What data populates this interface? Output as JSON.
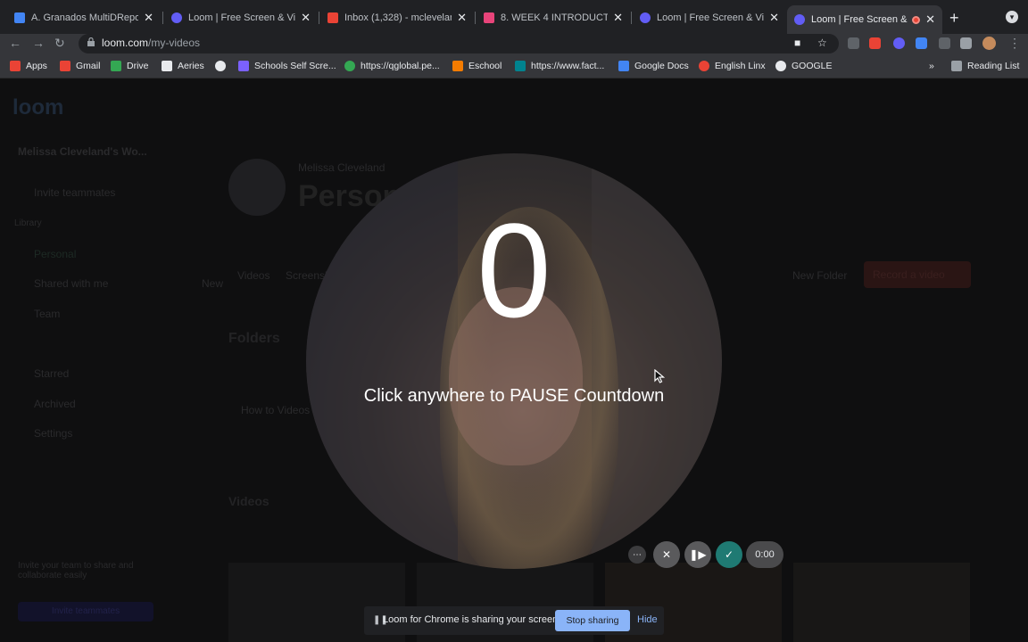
{
  "tabs": [
    {
      "title": "A. Granados MultiDReport",
      "favicon_color": "#4285f4"
    },
    {
      "title": "Loom | Free Screen & Video",
      "favicon_color": "#625df5"
    },
    {
      "title": "Inbox (1,328) - mcleveland",
      "favicon_color": "#ea4335"
    },
    {
      "title": "8. WEEK 4 INTRODUCTION",
      "favicon_color": "#e8447a"
    },
    {
      "title": "Loom | Free Screen & Video",
      "favicon_color": "#625df5"
    },
    {
      "title": "Loom | Free Screen & V",
      "favicon_color": "#625df5"
    }
  ],
  "toolbar": {
    "url_domain": "loom.com",
    "url_path": "/my-videos"
  },
  "bookmarks": [
    {
      "label": "Apps",
      "color": "#ea4335"
    },
    {
      "label": "Gmail",
      "color": "#ea4335"
    },
    {
      "label": "Drive",
      "color": "#34a853"
    },
    {
      "label": "Aeries",
      "color": "#e8eaed"
    },
    {
      "label": "",
      "color": "#e8eaed"
    },
    {
      "label": "Schools Self Scre...",
      "color": "#7b61ff"
    },
    {
      "label": "https://qglobal.pe...",
      "color": "#34a853"
    },
    {
      "label": "Eschool",
      "color": "#f57c00"
    },
    {
      "label": "https://www.fact...",
      "color": "#00838f"
    },
    {
      "label": "Google Docs",
      "color": "#4285f4"
    },
    {
      "label": "English Linx",
      "color": "#ea4335"
    },
    {
      "label": "GOOGLE",
      "color": "#e8eaed"
    }
  ],
  "reading_list": "Reading List",
  "overlay": {
    "countdown": "0",
    "hint": "Click anywhere to PAUSE Countdown"
  },
  "recorder": {
    "timer": "0:00"
  },
  "share_bar": {
    "message": "Loom for Chrome is sharing your screen.",
    "stop_label": "Stop sharing",
    "hide_label": "Hide"
  },
  "dimmed_page": {
    "logo": "loom",
    "workspace": "Melissa Cleveland's Wo...",
    "invite": "Invite teammates",
    "library": "Library",
    "nav": [
      "Personal",
      "Shared with me",
      "Team",
      "Starred",
      "Archived",
      "Settings"
    ],
    "profile_name": "Melissa Cleveland",
    "page_title": "Personal",
    "tabs": [
      "Videos",
      "Screenshots"
    ],
    "new_button": "New",
    "new_folder": "New Folder",
    "record_button": "Record a video",
    "folders_heading": "Folders",
    "folder_name": "How to Videos",
    "videos_heading": "Videos",
    "promo_title": "Invite your team to share and collaborate easily",
    "promo_button": "Invite teammates"
  }
}
